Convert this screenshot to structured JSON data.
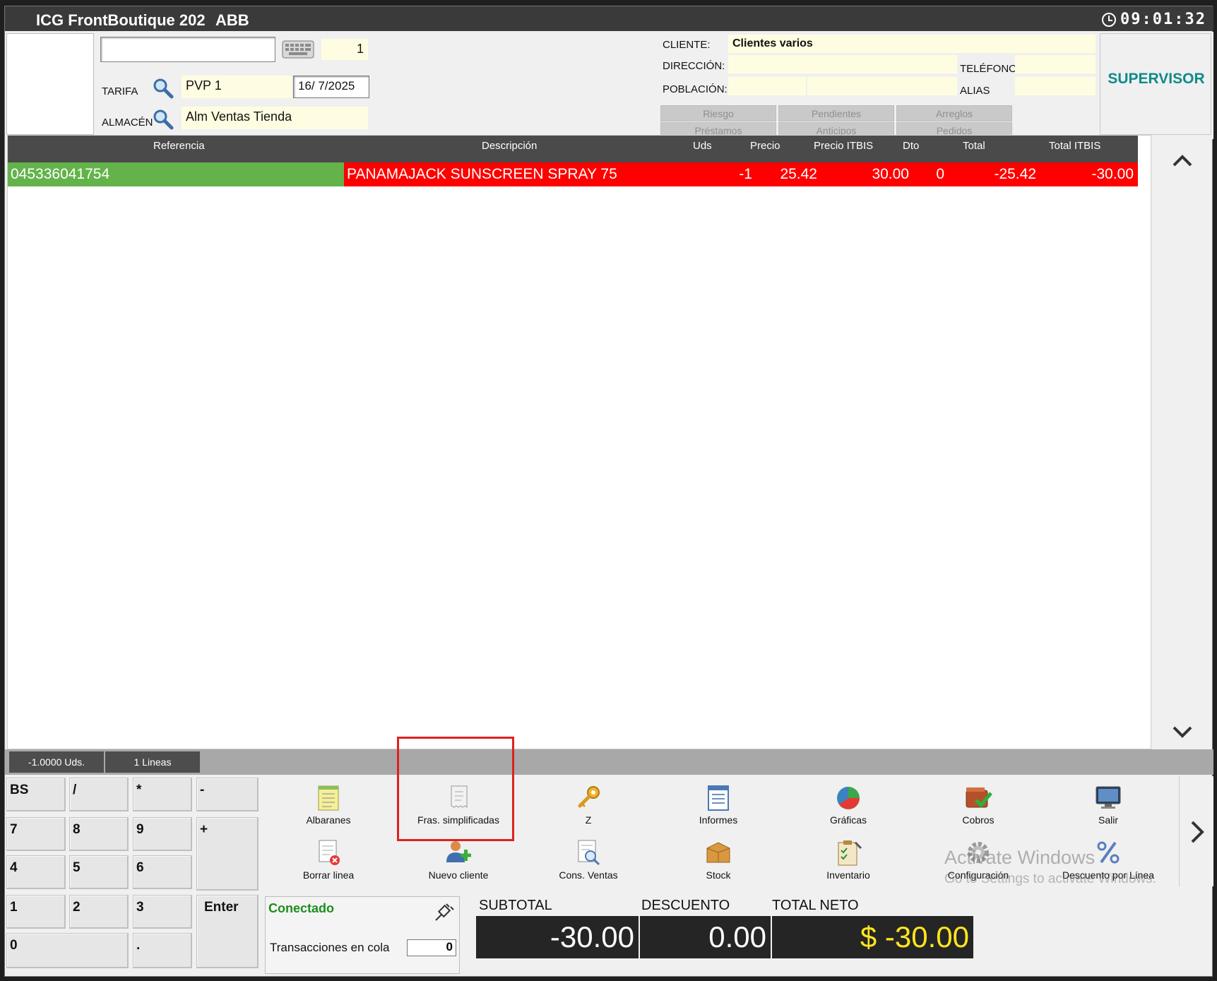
{
  "window": {
    "app_title": "ICG FrontBoutique 202",
    "user": "ABB",
    "time": "09:01:32"
  },
  "header": {
    "barcode_value": "",
    "quantity": "1",
    "tarifa_label": "TARIFA",
    "tarifa_value": "PVP 1",
    "date": "16/ 7/2025",
    "almacen_label": "ALMACÉN",
    "almacen_value": "Alm Ventas Tienda",
    "cliente_label": "CLIENTE:",
    "cliente_value": "Clientes varios",
    "direccion_label": "DIRECCIÓN:",
    "direccion_value": "",
    "telefono_label": "TELÉFONO",
    "telefono_value": "",
    "poblacion_label": "POBLACIÓN:",
    "poblacion_value": "",
    "alias_label": "ALIAS",
    "alias_value": "",
    "supervisor": "SUPERVISOR",
    "client_buttons": [
      "Riesgo",
      "Pendientes",
      "Arreglos",
      "Préstamos",
      "Anticipos",
      "Pedidos"
    ]
  },
  "grid": {
    "columns": [
      "Referencia",
      "Descripción",
      "Uds",
      "Precio",
      "Precio ITBIS",
      "Dto",
      "Total",
      "Total ITBIS"
    ],
    "rows": [
      {
        "referencia": "045336041754",
        "descripcion": "PANAMAJACK SUNSCREEN SPRAY 75",
        "uds": "-1",
        "precio": "25.42",
        "precio_itbis": "30.00",
        "dto": "0",
        "total": "-25.42",
        "total_itbis": "-30.00"
      }
    ]
  },
  "status": {
    "units": "-1.0000 Uds.",
    "lines": "1 Lineas"
  },
  "keypad": [
    "BS",
    "/",
    "*",
    "-",
    "7",
    "8",
    "9",
    "+",
    "4",
    "5",
    "6",
    "1",
    "2",
    "3",
    "Enter",
    "0",
    "."
  ],
  "functions": [
    {
      "label": "Albaranes",
      "icon": "notepad-icon"
    },
    {
      "label": "Fras. simplificadas",
      "icon": "receipt-icon"
    },
    {
      "label": "Z",
      "icon": "key-icon"
    },
    {
      "label": "Informes",
      "icon": "report-icon"
    },
    {
      "label": "Gráficas",
      "icon": "pie-chart-icon"
    },
    {
      "label": "Cobros",
      "icon": "wallet-check-icon"
    },
    {
      "label": "Salir",
      "icon": "monitor-icon"
    },
    {
      "label": "Borrar linea",
      "icon": "delete-doc-icon"
    },
    {
      "label": "Nuevo cliente",
      "icon": "add-user-icon"
    },
    {
      "label": "Cons. Ventas",
      "icon": "search-doc-icon"
    },
    {
      "label": "Stock",
      "icon": "box-icon"
    },
    {
      "label": "Inventario",
      "icon": "clipboard-icon"
    },
    {
      "label": "Configuración",
      "icon": "gear-icon"
    },
    {
      "label": "Descuento por Línea",
      "icon": "percent-icon"
    }
  ],
  "watermark": {
    "line1": "Activate Windows",
    "line2": "Go to Settings to activate Windows."
  },
  "bottom": {
    "connection": "Conectado",
    "queue_label": "Transacciones en cola",
    "queue_value": "0",
    "subtotal_label": "SUBTOTAL",
    "subtotal_value": "-30.00",
    "descuento_label": "DESCUENTO",
    "descuento_value": "0.00",
    "total_neto_label": "TOTAL NETO",
    "total_neto_value": "$ -30.00"
  },
  "colors": {
    "reference_bg": "#63b34a",
    "row_bg": "#ff0000",
    "total_neto": "#ffe51f",
    "supervisor": "#0f8a8a",
    "connected": "#1e8e1e",
    "highlight": "#e02020"
  }
}
